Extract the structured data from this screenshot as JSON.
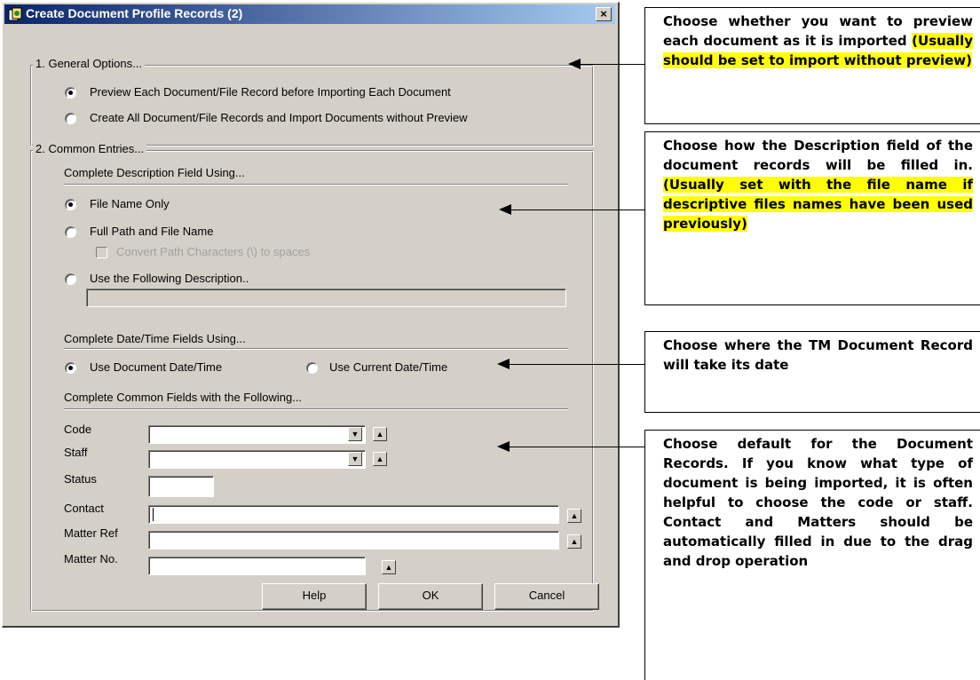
{
  "window": {
    "title": "Create Document Profile Records (2)",
    "close_label": "×"
  },
  "general": {
    "legend": "1. General Options...",
    "preview_label": "Preview Each Document/File Record before Importing Each Document",
    "nopreview_label": "Create All Document/File Records and Import Documents without Preview",
    "selected": "preview"
  },
  "common": {
    "legend": "2. Common Entries...",
    "desc_heading": "Complete Description Field Using...",
    "desc_options": {
      "filename": "File Name Only",
      "fullpath": "Full Path and File Name",
      "convert": "Convert Path Characters (\\) to spaces",
      "following": "Use the Following Description.."
    },
    "desc_selected": "filename",
    "desc_value": "",
    "date_heading": "Complete Date/Time Fields Using...",
    "date_document": "Use Document Date/Time",
    "date_current": "Use Current Date/Time",
    "date_selected": "document",
    "fields_heading": "Complete Common Fields with the Following...",
    "fields": {
      "code": {
        "label": "Code",
        "value": ""
      },
      "staff": {
        "label": "Staff",
        "value": ""
      },
      "status": {
        "label": "Status",
        "value": ""
      },
      "contact": {
        "label": "Contact",
        "value": ""
      },
      "matter_ref": {
        "label": "Matter Ref",
        "value": ""
      },
      "matter_no": {
        "label": "Matter No.",
        "value": ""
      }
    }
  },
  "buttons": {
    "help": "Help",
    "ok": "OK",
    "cancel": "Cancel"
  },
  "annotations": {
    "note1": {
      "text": "Choose whether you want to preview each document as it is imported ",
      "highlight": "(Usually should be set to import without preview)"
    },
    "note2": {
      "text": "Choose how the Description field of the document records will be filled in. ",
      "highlight": "(Usually set with the file name if descriptive files names have been used previously)"
    },
    "note3": {
      "text": "Choose where the TM Document Record will take its date"
    },
    "note4": {
      "text": "Choose default for the Document Records. If you know what type of document is being imported, it is often helpful to choose the code or staff. Contact and Matters should be automatically filled in due to the drag and drop operation"
    },
    "highlight_color": "#ffff00"
  }
}
